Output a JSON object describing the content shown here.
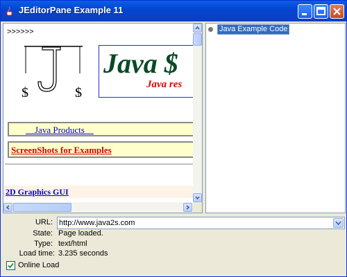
{
  "window": {
    "title": "JEditorPane Example 11",
    "controls": [
      "minimize-icon",
      "maximize-icon",
      "close-icon"
    ]
  },
  "page": {
    "arrows": ">>>>>>",
    "banner_title": "Java $",
    "banner_subtitle": "Java res",
    "link_products": "    Java Products    ",
    "link_screenshots": "ScreenShots for Examples",
    "section_heading": "2D Graphics GUI"
  },
  "tree": {
    "items": [
      {
        "label": "Java Example Code",
        "selected": true
      }
    ]
  },
  "status": {
    "url_label": "URL:",
    "url_value": "http://www.java2s.com",
    "state_label": "State:",
    "state_value": "Page loaded.",
    "type_label": "Type:",
    "type_value": "text/html",
    "load_label": "Load time:",
    "load_value": "3.235 seconds",
    "online_label": "Online Load",
    "online_checked": true
  },
  "colors": {
    "titlebar": "#0645d0",
    "selection": "#316ac5",
    "link": "#0000cc",
    "accent_red": "#d60000"
  }
}
